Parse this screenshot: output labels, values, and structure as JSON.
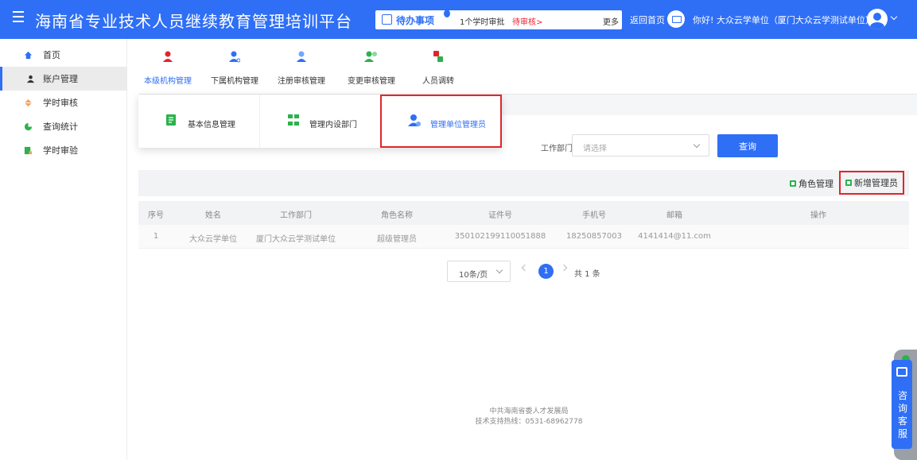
{
  "header": {
    "title": "海南省专业技术人员继续教育管理培训平台",
    "todo_label": "待办事项",
    "todo_text": "1个学时审批",
    "todo_link": "待审核>",
    "more": "更多",
    "home": "返回首页",
    "greeting": "你好! 大众云学单位（厦门大众云学测试单位）"
  },
  "sidebar": {
    "items": [
      {
        "label": "首页",
        "icon": "home-icon"
      },
      {
        "label": "账户管理",
        "icon": "user-icon"
      },
      {
        "label": "学时审核",
        "icon": "diamond-icon"
      },
      {
        "label": "查询统计",
        "icon": "pie-chart-icon"
      },
      {
        "label": "学时审验",
        "icon": "document-check-icon"
      }
    ],
    "active_index": 1
  },
  "subnav": {
    "items": [
      {
        "label": "本级机构管理",
        "icon": "org-icon"
      },
      {
        "label": "下属机构管理",
        "icon": "sub-org-icon"
      },
      {
        "label": "注册审核管理",
        "icon": "register-icon"
      },
      {
        "label": "变更审核管理",
        "icon": "change-icon"
      },
      {
        "label": "人员调转",
        "icon": "transfer-icon"
      }
    ],
    "active_index": 0
  },
  "dropdown": {
    "items": [
      {
        "label": "基本信息管理",
        "icon": "edit-doc-icon"
      },
      {
        "label": "管理内设部门",
        "icon": "department-icon"
      },
      {
        "label": "管理单位管理员",
        "icon": "admin-user-icon"
      }
    ],
    "highlight_index": 2
  },
  "filter": {
    "label": "工作部门",
    "placeholder": "请选择",
    "query_button": "查询"
  },
  "toolbar": {
    "role_manage": "角色管理",
    "new_admin": "新增管理员"
  },
  "table": {
    "headers": [
      "序号",
      "姓名",
      "工作部门",
      "角色名称",
      "证件号",
      "手机号",
      "邮箱",
      "操作"
    ],
    "rows": [
      [
        "1",
        "大众云学单位",
        "厦门大众云学测试单位",
        "超级管理员",
        "350102199110051888",
        "18250857003",
        "4141414@11.com",
        ""
      ]
    ]
  },
  "pagination": {
    "page_size": "10条/页",
    "current_page": "1",
    "total": "共 1 条"
  },
  "footer": {
    "line1": "中共海南省委人才发展局",
    "line2": "技术支持热线：0531-68962778"
  },
  "customer_service": {
    "label": "咨询客服"
  },
  "colors": {
    "primary": "#2f6ff6",
    "highlight_border": "#e0262a",
    "success_icon": "#2bb24c"
  }
}
